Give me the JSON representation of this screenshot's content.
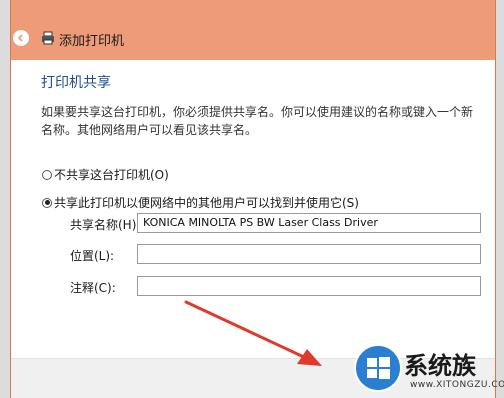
{
  "window": {
    "title": "添加打印机"
  },
  "section": {
    "title": "打印机共享",
    "description": "如果要共享这台打印机，你必须提供共享名。你可以使用建议的名称或键入一个新名称。其他网络用户可以看见该共享名。"
  },
  "options": [
    {
      "label": "不共享这台打印机(O)",
      "selected": false
    },
    {
      "label": "共享此打印机以便网络中的其他用户可以找到并使用它(S)",
      "selected": true
    }
  ],
  "fields": {
    "share_name": {
      "label": "共享名称(H):",
      "value": "KONICA MINOLTA PS BW Laser Class Driver"
    },
    "location": {
      "label": "位置(L):",
      "value": ""
    },
    "comment": {
      "label": "注释(C):",
      "value": ""
    }
  },
  "watermark": {
    "name": "系统族",
    "url": "www.XITONGZU.COM"
  },
  "colors": {
    "titlebar": "#ee9b77",
    "heading": "#1f4e8c",
    "annotation_arrow": "#e03a2c",
    "watermark_logo": "#2b7fd1"
  },
  "icons": [
    "back-arrow-icon",
    "printer-icon",
    "annotation-arrow",
    "watermark-logo-icon"
  ]
}
